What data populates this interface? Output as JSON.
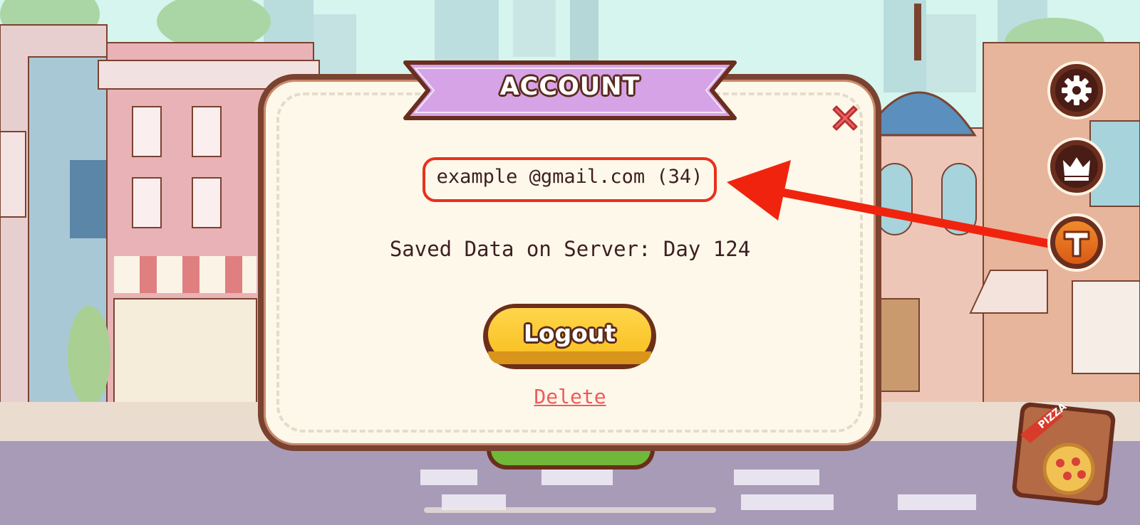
{
  "dialog": {
    "title": "ACCOUNT",
    "email": "example @gmail.com (34)",
    "saved_data": "Saved Data on Server: Day 124",
    "logout_label": "Logout",
    "delete_label": "Delete"
  },
  "side_buttons": [
    {
      "name": "settings",
      "icon": "gear-icon"
    },
    {
      "name": "rankings",
      "icon": "crown-icon"
    },
    {
      "name": "account",
      "icon": "t-icon"
    }
  ],
  "pizza_box": {
    "label": "PIZZA",
    "icon": "pizza-box-icon"
  },
  "colors": {
    "banner": "#d6a3e6",
    "dialog_bg": "#fdf8ea",
    "dialog_border": "#7a4230",
    "highlight_red": "#e8301e",
    "logout_yellow": "#f8be21",
    "delete_red": "#f05a5a"
  }
}
